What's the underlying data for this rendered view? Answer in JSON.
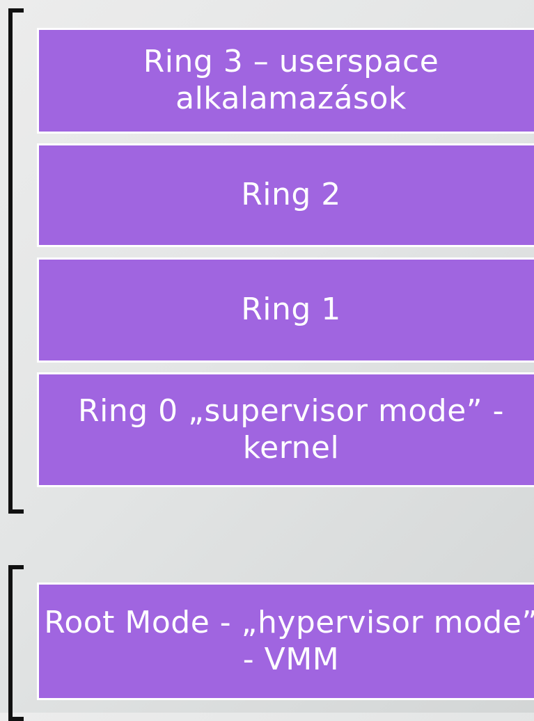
{
  "diagram": {
    "upper_group": {
      "rings": [
        {
          "label": "Ring 3 – userspace alkalamazások"
        },
        {
          "label": "Ring 2"
        },
        {
          "label": "Ring 1"
        },
        {
          "label": "Ring 0 „supervisor mode” - kernel"
        }
      ]
    },
    "lower_group": {
      "root": {
        "label": "Root Mode - „hypervisor mode” - VMM"
      }
    },
    "colors": {
      "box_fill": "#a065e0",
      "box_border": "#ffffff",
      "text": "#ffffff",
      "bracket": "#111111"
    }
  }
}
